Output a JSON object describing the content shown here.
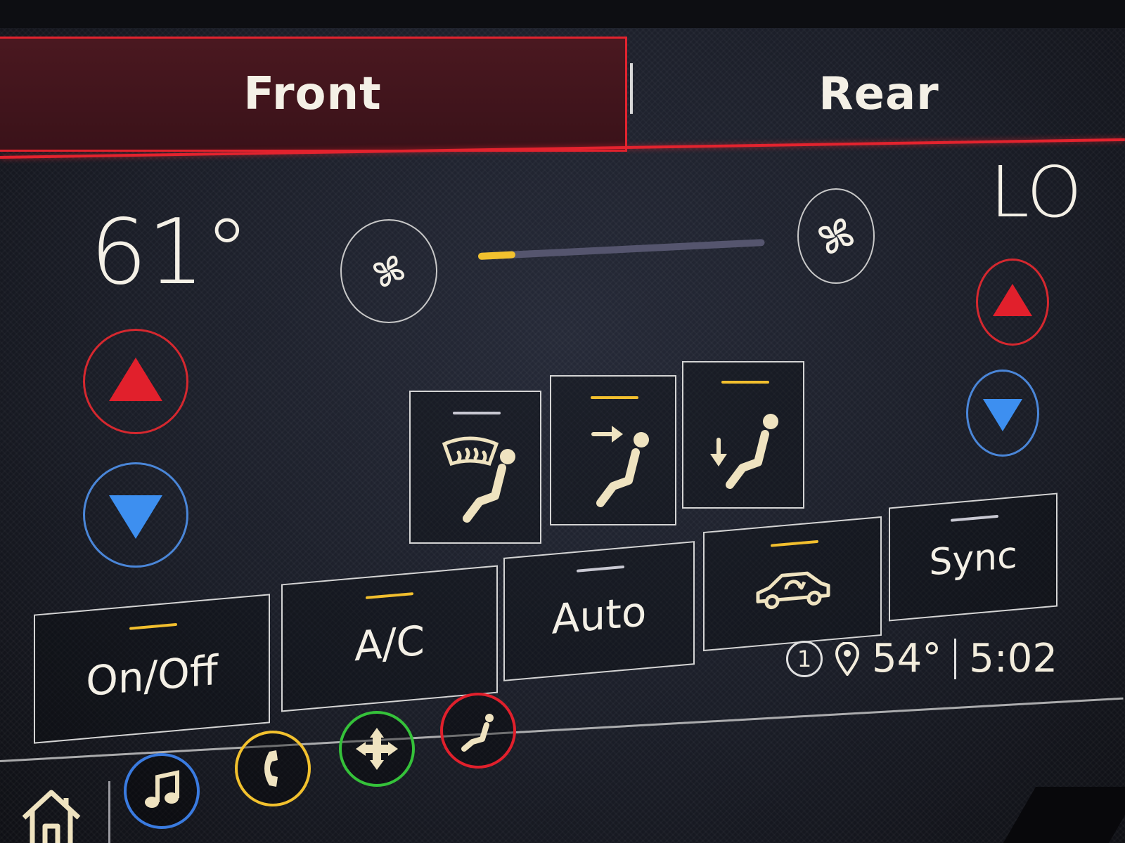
{
  "tabs": {
    "front": "Front",
    "rear": "Rear",
    "active": "front"
  },
  "temperature": {
    "left": "61°",
    "right": "LO"
  },
  "fan": {
    "level": 0.13,
    "min_icon": "fan-low-icon",
    "max_icon": "fan-high-icon"
  },
  "airflow_modes": [
    {
      "icon": "defrost-floor-icon",
      "active": false
    },
    {
      "icon": "vent-face-icon",
      "active": true
    },
    {
      "icon": "vent-floor-icon",
      "active": true
    }
  ],
  "controls": {
    "on_off": {
      "label": "On/Off",
      "active": true
    },
    "ac": {
      "label": "A/C",
      "active": true
    },
    "auto": {
      "label": "Auto",
      "active": false
    },
    "recirc": {
      "icon": "recirculation-car-icon",
      "active": true
    },
    "sync": {
      "label": "Sync",
      "active": false
    }
  },
  "status": {
    "badge": "1",
    "location_icon": "location-pin-icon",
    "outside_temp": "54°",
    "time": "5:02"
  },
  "dock": [
    {
      "icon": "home-icon"
    },
    {
      "icon": "music-icon",
      "color": "#3a7be0"
    },
    {
      "icon": "phone-icon",
      "color": "#f2c12e"
    },
    {
      "icon": "navigation-icon",
      "color": "#35c23a"
    },
    {
      "icon": "climate-seat-icon",
      "color": "#e1202c"
    }
  ],
  "colors": {
    "accent_red": "#e3232e",
    "indicator_on": "#f2bf2e",
    "cool_blue": "#3d8ff0"
  }
}
